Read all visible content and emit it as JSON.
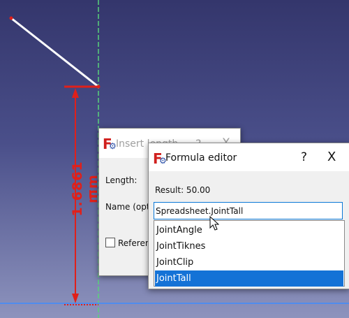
{
  "viewport": {
    "dimension_label": "1.6861 mm",
    "line_color": "#ffffff",
    "dimension_color": "#e0201a",
    "axis_color_green": "#58d37a",
    "axis_color_blue": "#3d8cff"
  },
  "insert_length_dialog": {
    "title": "Insert length",
    "help": "?",
    "close": "X",
    "length_label": "Length:",
    "name_label": "Name (optional)",
    "reference_label": "Reference"
  },
  "formula_editor": {
    "icon_letter": "F",
    "title": "Formula editor",
    "help": "?",
    "close": "X",
    "result": "Result: 50.00",
    "expression_value": "Spreadsheet.JointTall",
    "suggestions": [
      {
        "label": "JointAngle",
        "selected": false
      },
      {
        "label": "JointTiknes",
        "selected": false
      },
      {
        "label": "JointClip",
        "selected": false
      },
      {
        "label": "JointTall",
        "selected": true
      }
    ],
    "accent": "#1472d6"
  },
  "icons": {
    "app": "freecad-icon",
    "cursor": "mouse-cursor-icon"
  }
}
